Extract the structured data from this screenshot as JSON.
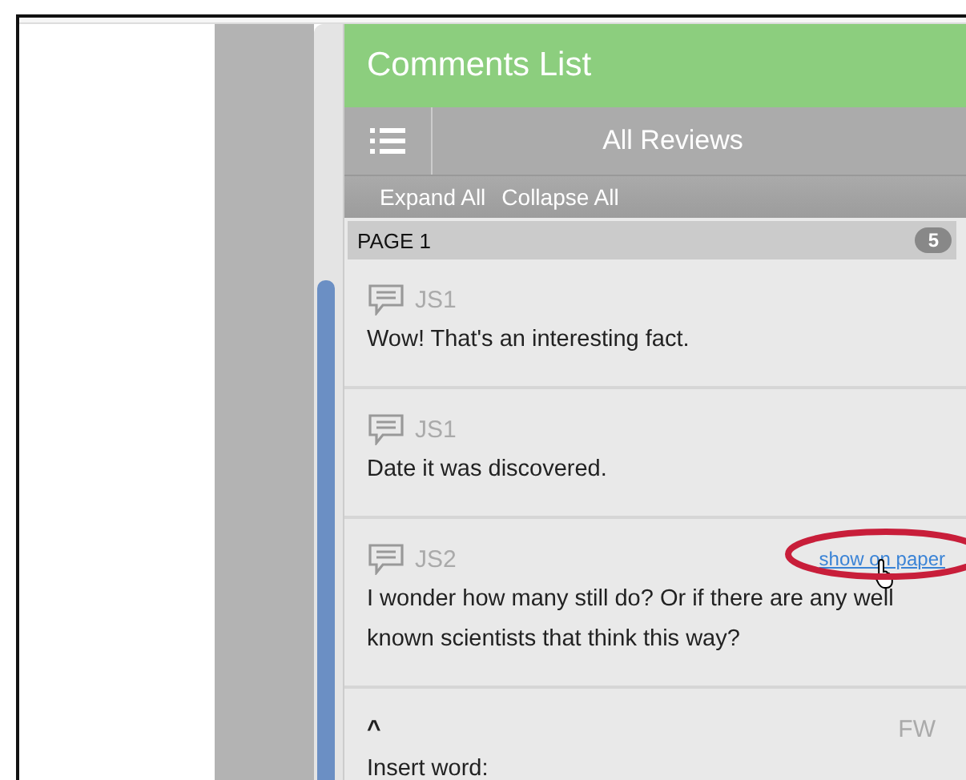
{
  "panel": {
    "title": "Comments List",
    "filter": "All Reviews",
    "actions": [
      "Expand All",
      "Collapse All"
    ]
  },
  "page": {
    "label": "PAGE 1",
    "count": "5"
  },
  "comments": [
    {
      "kind": "comment",
      "author": "JS1",
      "text": "Wow! That's an interesting fact."
    },
    {
      "kind": "comment",
      "author": "JS1",
      "text": "Date it was discovered."
    },
    {
      "kind": "comment",
      "author": "JS2",
      "text": "I wonder how many still do? Or if there are any well known scientists that think this way?",
      "link": "show on paper"
    },
    {
      "kind": "insert",
      "marker": "^",
      "author": "FW",
      "text": "Insert word:"
    }
  ]
}
